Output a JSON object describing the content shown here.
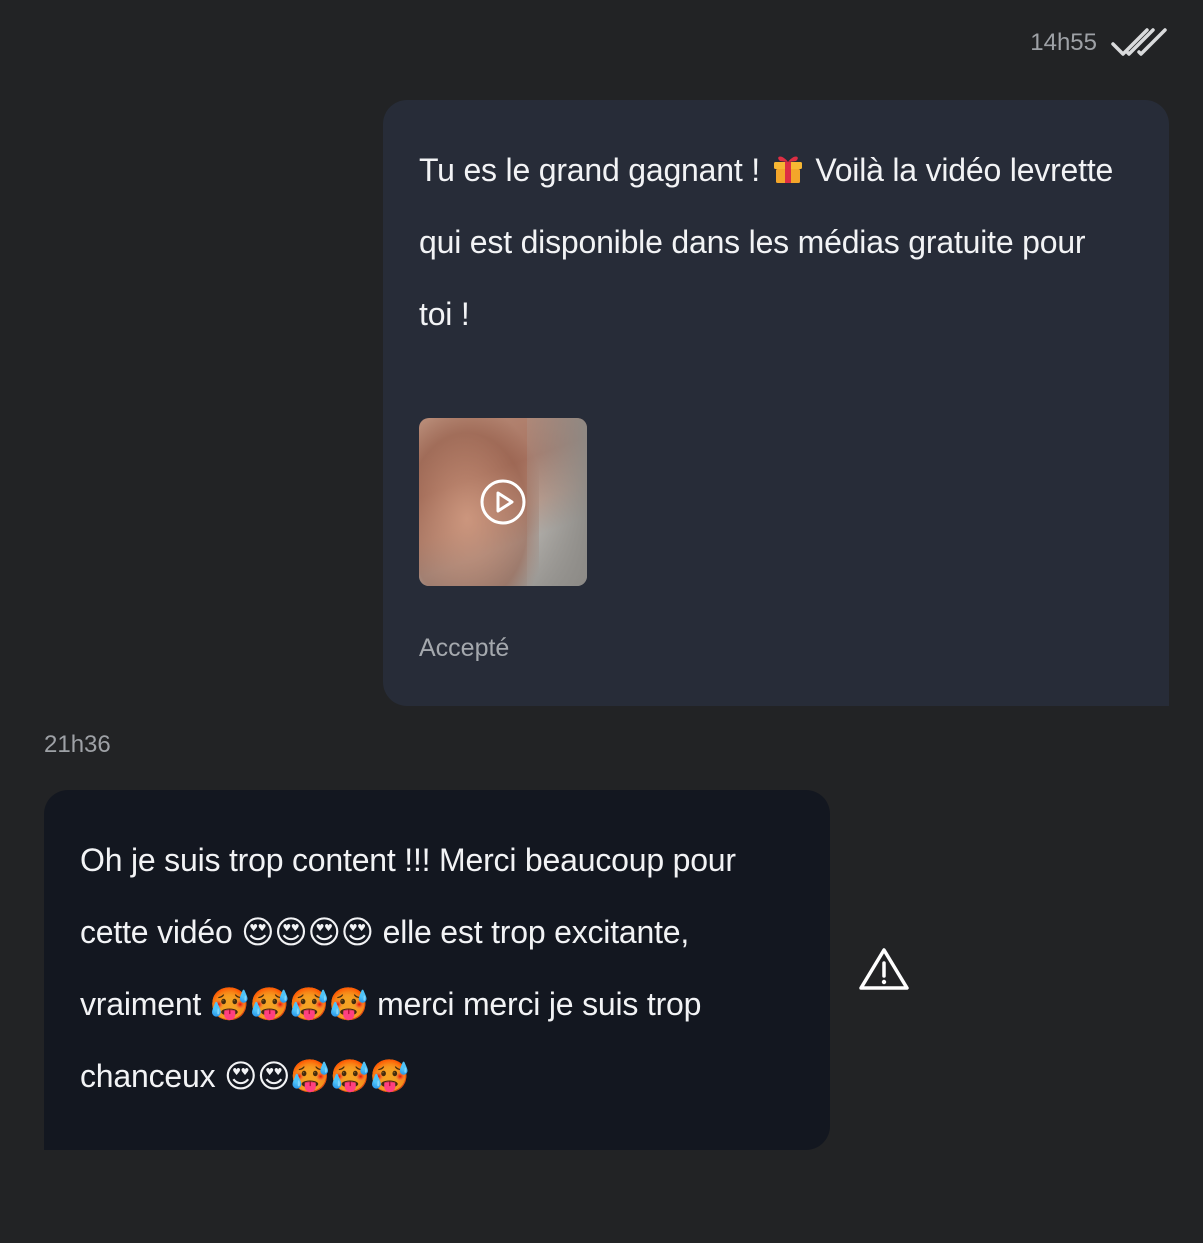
{
  "outgoing": {
    "time": "14h55",
    "status_icon": "double-check-icon",
    "text_part1": "Tu es le grand gagnant ! ",
    "text_emoji": "🎁",
    "text_part2": " Voilà la vidéo levrette qui est disponible dans les médias gratuite pour toi !",
    "media": {
      "type": "video",
      "icon": "play-icon"
    },
    "status_label": "Accepté"
  },
  "incoming": {
    "time": "21h36",
    "text_seg1": "Oh je suis trop content !!! Merci beaucoup pour cette vidéo ",
    "emojis1": "😍😍😍😍",
    "text_seg2": " elle est trop excitante, vraiment ",
    "emojis2": "🥵🥵🥵🥵",
    "text_seg3": " merci merci je suis trop chanceux ",
    "emojis3": "😍😍🥵🥵🥵",
    "report_icon": "warning-icon"
  },
  "colors": {
    "background": "#222325",
    "outgoing_bubble": "#272c38",
    "incoming_bubble": "#131720",
    "muted_text": "#9ea1a6"
  }
}
